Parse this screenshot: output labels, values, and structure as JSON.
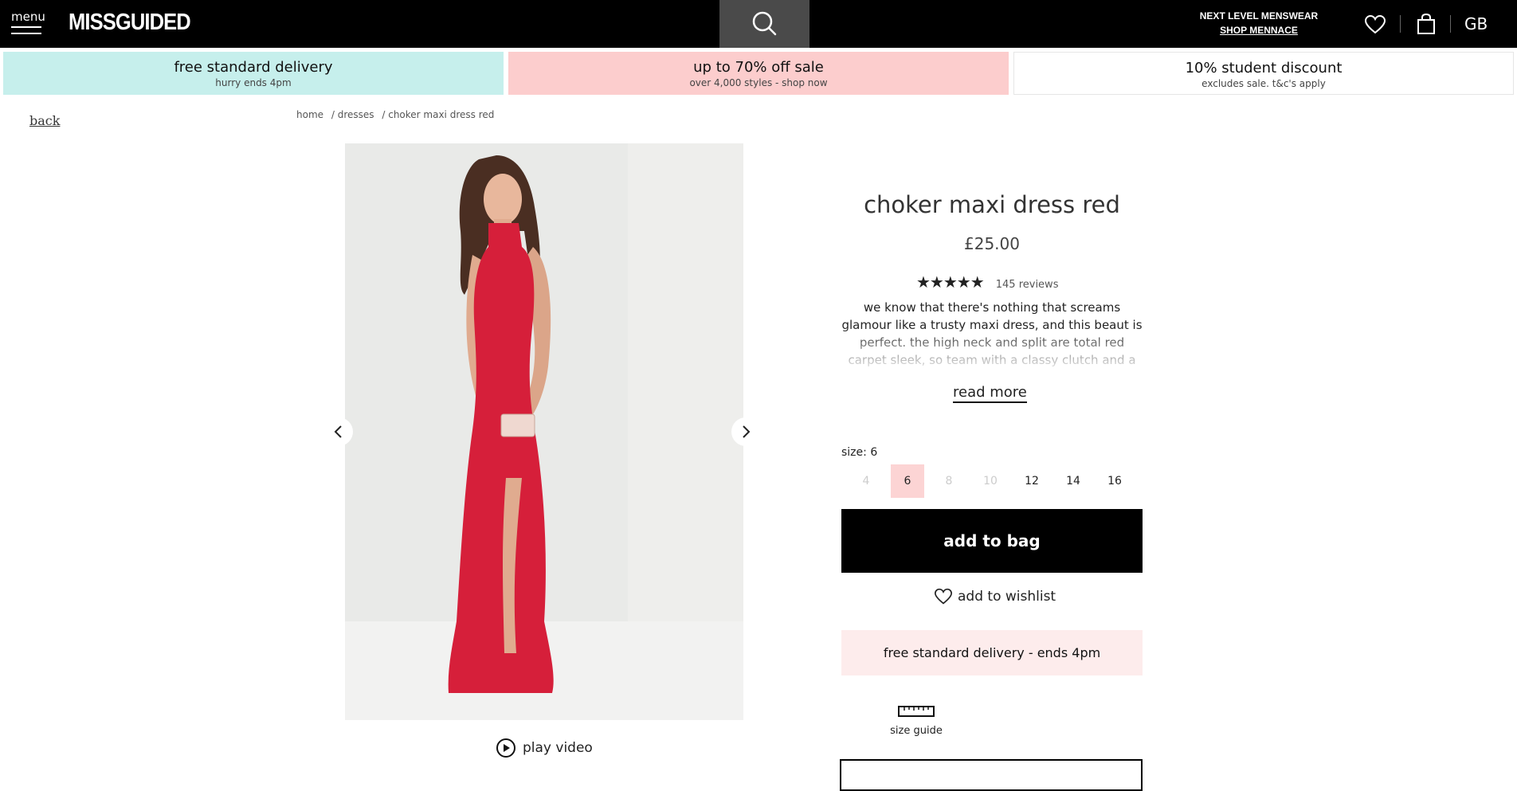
{
  "header": {
    "menu_label": "menu",
    "logo": "MISSGUIDED",
    "menswear_title": "NEXT LEVEL MENSWEAR",
    "menswear_link": "SHOP MENNACE",
    "region": "GB",
    "background": "#000000"
  },
  "promos": [
    {
      "title": "free standard delivery",
      "subtitle": "hurry ends 4pm",
      "color": "#c6efec"
    },
    {
      "title": "up to 70% off sale",
      "subtitle": "over 4,000 styles - shop now",
      "color": "#fccdcd"
    },
    {
      "title": "10% student discount",
      "subtitle": "excludes sale. t&c's apply",
      "color": "#ffffff"
    }
  ],
  "back_label": "back",
  "breadcrumb": [
    "home",
    "/ dresses",
    "/ choker maxi dress red"
  ],
  "gallery": {
    "prev_icon": "chevron-left-icon",
    "next_icon": "chevron-right-icon",
    "play_video_label": "play video"
  },
  "product": {
    "title": "choker maxi dress red",
    "price": "£25.00",
    "rating": 4.5,
    "stars": "★★★★★",
    "reviews": "145 reviews",
    "description": "we know that there's nothing that screams glamour like a trusty maxi dress, and this beaut is perfect. the high neck and split are total red carpet sleek, so team with a classy clutch and a",
    "read_more": "read more",
    "size_label": "size: 6",
    "sizes": [
      {
        "label": "4",
        "available": false,
        "selected": false
      },
      {
        "label": "6",
        "available": true,
        "selected": true
      },
      {
        "label": "8",
        "available": false,
        "selected": false
      },
      {
        "label": "10",
        "available": false,
        "selected": false
      },
      {
        "label": "12",
        "available": true,
        "selected": false
      },
      {
        "label": "14",
        "available": true,
        "selected": false
      },
      {
        "label": "16",
        "available": true,
        "selected": false
      }
    ],
    "add_to_bag": "add to bag",
    "add_to_wishlist": "add to wishlist",
    "delivery_banner": "free standard delivery - ends 4pm",
    "size_guide": "size guide",
    "accent_pink": "#fcd4d4"
  }
}
